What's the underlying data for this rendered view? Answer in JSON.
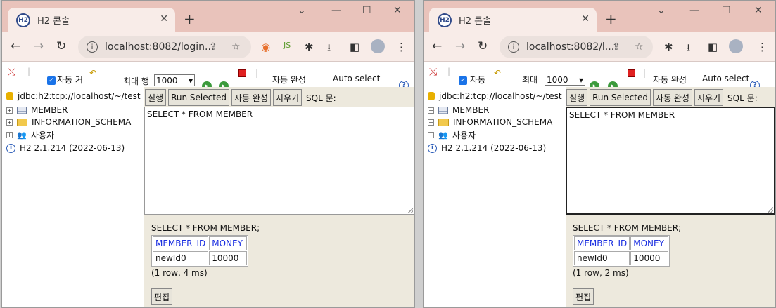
{
  "windows": [
    {
      "tab_title": "H2 콘솔",
      "tab_icon_text": "H2",
      "url": "localhost:8082/login...",
      "toolbar": {
        "autocommit": "자동 커",
        "max_rows_label": "최대 행",
        "max_rows_value": "1000",
        "autocomplete_label": "자동 완성",
        "auto_select_label": "Auto select"
      },
      "tree": {
        "connection": "jdbc:h2:tcp://localhost/~/test",
        "items": [
          "MEMBER",
          "INFORMATION_SCHEMA",
          "사용자"
        ],
        "version": "H2 2.1.214 (2022-06-13)"
      },
      "buttons": {
        "run": "실행",
        "run_selected": "Run Selected",
        "autocomplete": "자동 완성",
        "clear": "지우기",
        "sql_label": "SQL 문:"
      },
      "editor_text": "SELECT * FROM MEMBER",
      "result": {
        "query": "SELECT * FROM MEMBER;",
        "columns": [
          "MEMBER_ID",
          "MONEY"
        ],
        "rows": [
          [
            "newId0",
            "10000"
          ]
        ],
        "count": "(1 row, 4 ms)",
        "edit_button": "편집"
      }
    },
    {
      "tab_title": "H2 콘솔",
      "tab_icon_text": "H2",
      "url": "localhost:8082/l...",
      "toolbar": {
        "autocommit": "자동",
        "max_rows_label": "최대",
        "max_rows_value": "1000",
        "autocomplete_label": "자동 완성",
        "auto_select_label": "Auto select"
      },
      "tree": {
        "connection": "jdbc:h2:tcp://localhost/~/test",
        "items": [
          "MEMBER",
          "INFORMATION_SCHEMA",
          "사용자"
        ],
        "version": "H2 2.1.214 (2022-06-13)"
      },
      "buttons": {
        "run": "실행",
        "run_selected": "Run Selected",
        "autocomplete": "자동 완성",
        "clear": "지우기",
        "sql_label": "SQL 문:"
      },
      "editor_text": "SELECT * FROM MEMBER",
      "result": {
        "query": "SELECT * FROM MEMBER;",
        "columns": [
          "MEMBER_ID",
          "MONEY"
        ],
        "rows": [
          [
            "newId0",
            "10000"
          ]
        ],
        "count": "(1 row, 2 ms)",
        "edit_button": "편집"
      }
    }
  ],
  "colors": {
    "tabbar": "#e9c3bb",
    "tab": "#f8ece8",
    "query_bg": "#ede9dd",
    "link": "#1a2ee0"
  },
  "icons": [
    "h2-logo-icon",
    "close-icon",
    "plus-icon",
    "minimize-icon",
    "maximize-icon",
    "back-icon",
    "forward-icon",
    "reload-icon",
    "info-icon",
    "share-icon",
    "star-icon",
    "extension-icon",
    "download-icon",
    "sidepanel-icon",
    "profile-icon",
    "menu-icon",
    "database-icon",
    "table-icon",
    "folder-icon",
    "users-icon",
    "help-icon"
  ]
}
